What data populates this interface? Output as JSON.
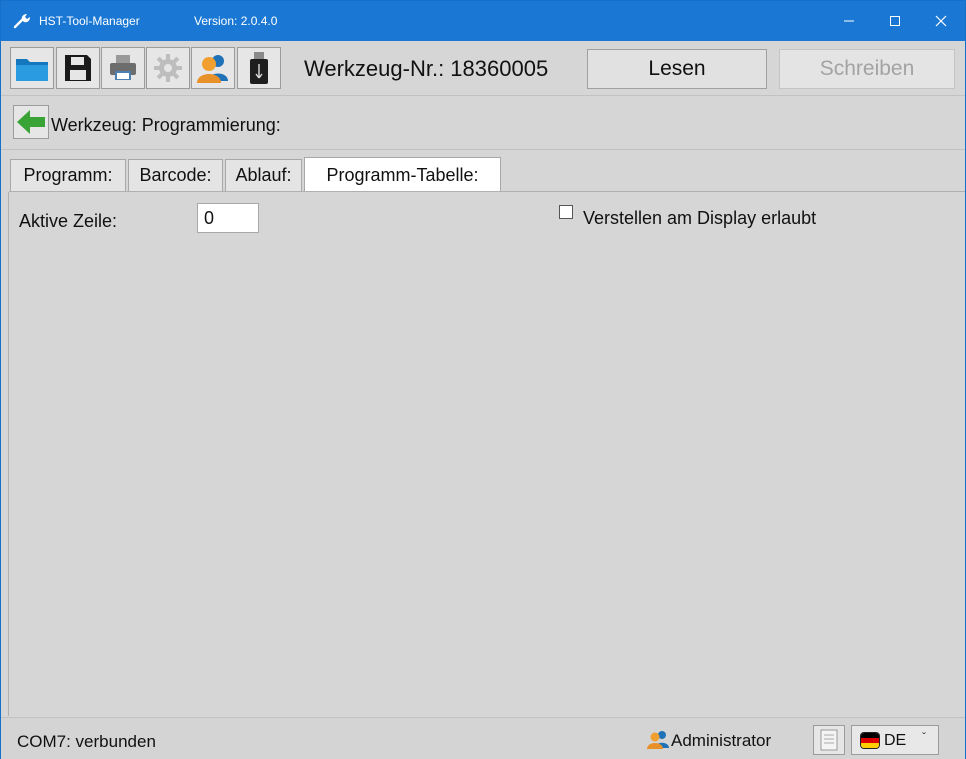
{
  "window": {
    "app_title": "HST-Tool-Manager",
    "version": "Version: 2.0.4.0"
  },
  "toolbar": {
    "buttons": [
      {
        "name": "open-folder-icon"
      },
      {
        "name": "save-disk-icon"
      },
      {
        "name": "printer-icon"
      },
      {
        "name": "gear-icon"
      },
      {
        "name": "user-icon"
      },
      {
        "name": "usb-stick-icon"
      }
    ],
    "tool_number": "Werkzeug-Nr.: 18360005",
    "read_label": "Lesen",
    "write_label": "Schreiben"
  },
  "breadcrumb": {
    "back_icon": "arrow-left-icon",
    "label": "Werkzeug: Programmierung:"
  },
  "tabs": [
    {
      "label": "Programm:",
      "active": false
    },
    {
      "label": "Barcode:",
      "active": false
    },
    {
      "label": "Ablauf:",
      "active": false
    },
    {
      "label": "Programm-Tabelle:",
      "active": true
    }
  ],
  "content": {
    "active_row_label": "Aktive Zeile:",
    "active_row_value": "0",
    "display_adjust_label": "Verstellen am Display erlaubt",
    "display_adjust_checked": false
  },
  "status": {
    "connection": "COM7: verbunden",
    "user": "Administrator",
    "language": "DE"
  },
  "colors": {
    "titlebar": "#1a78d4",
    "background": "#d6d6d6",
    "folder": "#1a8fd8",
    "arrow": "#3aa335",
    "user": "#e8952a"
  }
}
